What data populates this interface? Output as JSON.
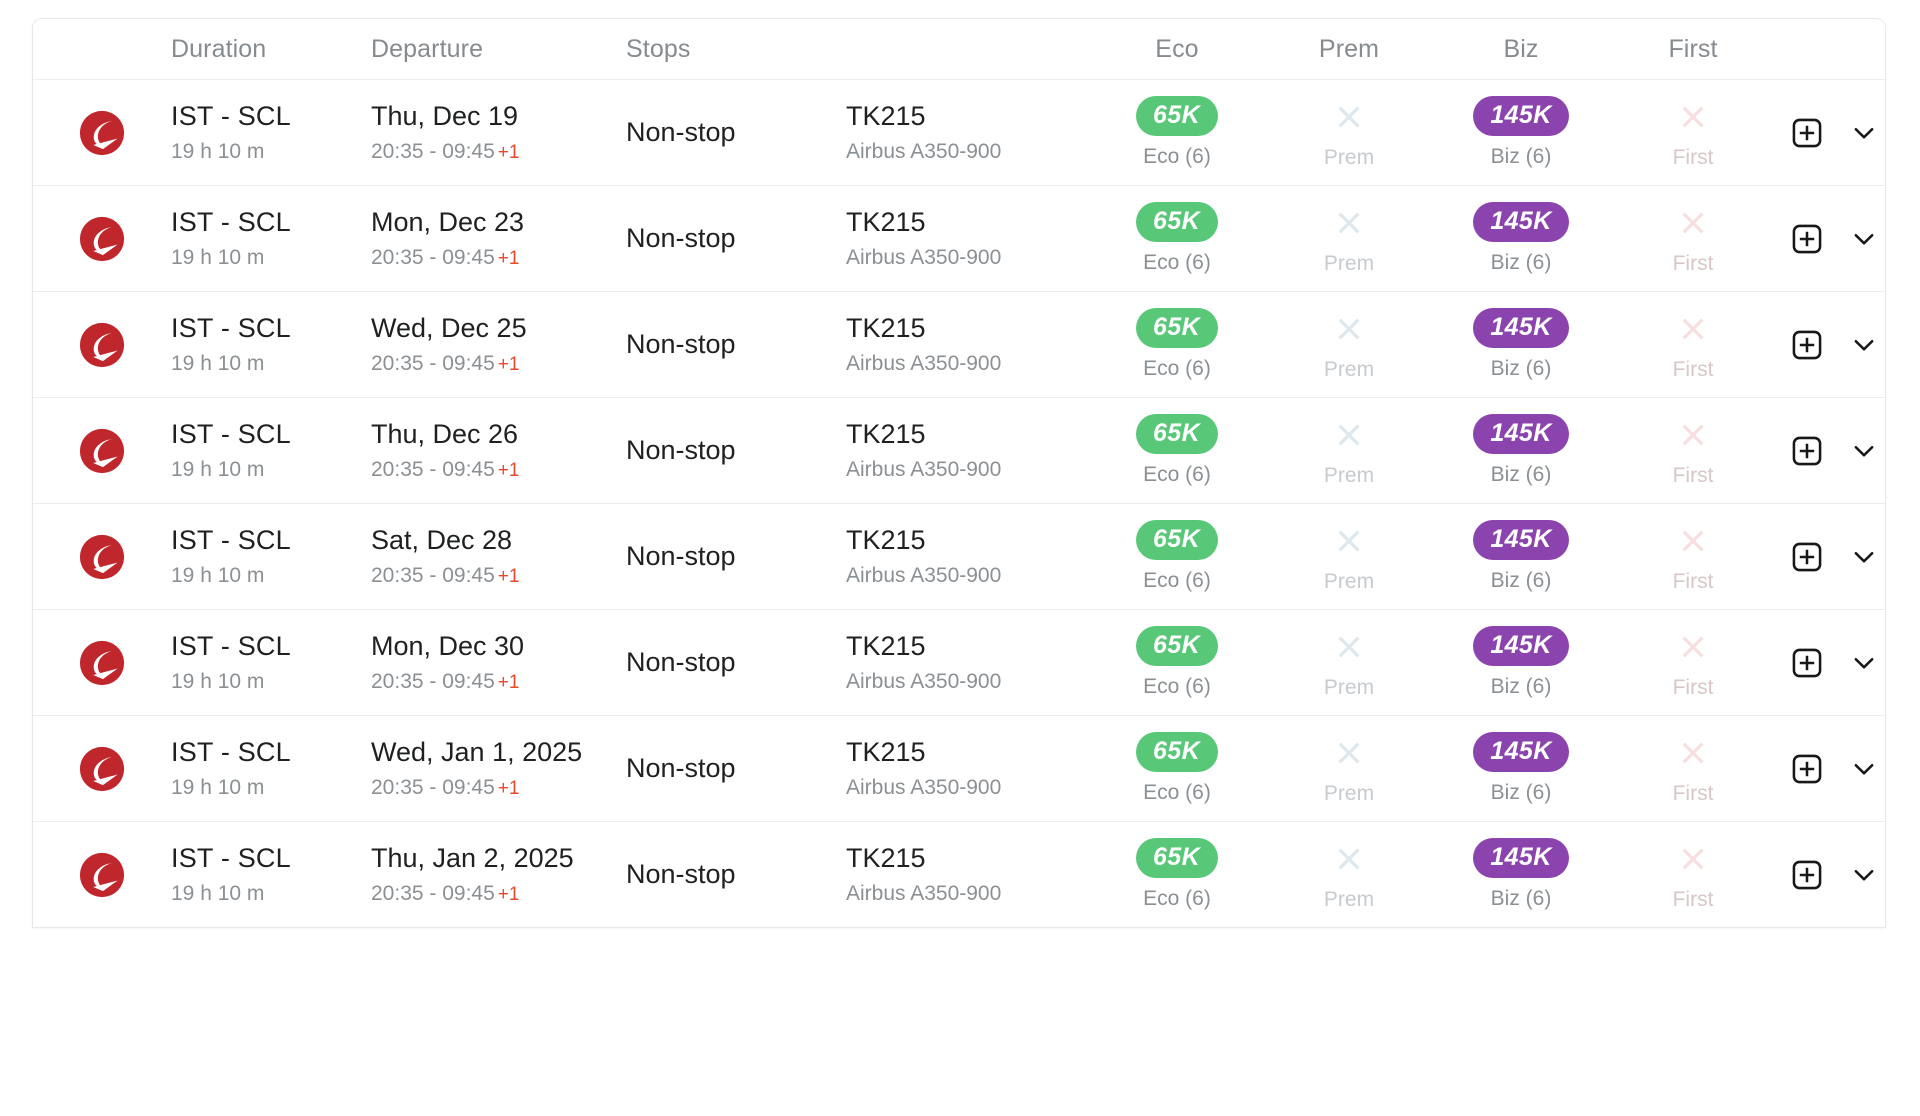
{
  "table": {
    "columns": [
      {
        "key": "airline",
        "label": "",
        "align": "center"
      },
      {
        "key": "duration",
        "label": "Duration",
        "align": "left"
      },
      {
        "key": "departure",
        "label": "Departure",
        "align": "left"
      },
      {
        "key": "stops",
        "label": "Stops",
        "align": "left"
      },
      {
        "key": "flight",
        "label": "",
        "align": "left"
      },
      {
        "key": "eco",
        "label": "Eco",
        "align": "center"
      },
      {
        "key": "prem",
        "label": "Prem",
        "align": "center"
      },
      {
        "key": "biz",
        "label": "Biz",
        "align": "center"
      },
      {
        "key": "first",
        "label": "First",
        "align": "center"
      },
      {
        "key": "actions",
        "label": "",
        "align": "left"
      }
    ],
    "headers": {
      "duration": "Duration",
      "departure": "Departure",
      "stops": "Stops",
      "eco": "Eco",
      "prem": "Prem",
      "biz": "Biz",
      "first": "First"
    },
    "rows": [
      {
        "airline": "Turkish Airlines",
        "route": "IST - SCL",
        "duration": "19 h 10 m",
        "date": "Thu, Dec 19",
        "times": "20:35 - 09:45",
        "day_offset": "+1",
        "stops": "Non-stop",
        "flight_number": "TK215",
        "aircraft": "Airbus A350-900",
        "eco": {
          "available": true,
          "price": "65K",
          "label": "Eco (6)"
        },
        "prem": {
          "available": false,
          "price": "",
          "label": "Prem"
        },
        "biz": {
          "available": true,
          "price": "145K",
          "label": "Biz (6)"
        },
        "first": {
          "available": false,
          "price": "",
          "label": "First"
        }
      },
      {
        "airline": "Turkish Airlines",
        "route": "IST - SCL",
        "duration": "19 h 10 m",
        "date": "Mon, Dec 23",
        "times": "20:35 - 09:45",
        "day_offset": "+1",
        "stops": "Non-stop",
        "flight_number": "TK215",
        "aircraft": "Airbus A350-900",
        "eco": {
          "available": true,
          "price": "65K",
          "label": "Eco (6)"
        },
        "prem": {
          "available": false,
          "price": "",
          "label": "Prem"
        },
        "biz": {
          "available": true,
          "price": "145K",
          "label": "Biz (6)"
        },
        "first": {
          "available": false,
          "price": "",
          "label": "First"
        }
      },
      {
        "airline": "Turkish Airlines",
        "route": "IST - SCL",
        "duration": "19 h 10 m",
        "date": "Wed, Dec 25",
        "times": "20:35 - 09:45",
        "day_offset": "+1",
        "stops": "Non-stop",
        "flight_number": "TK215",
        "aircraft": "Airbus A350-900",
        "eco": {
          "available": true,
          "price": "65K",
          "label": "Eco (6)"
        },
        "prem": {
          "available": false,
          "price": "",
          "label": "Prem"
        },
        "biz": {
          "available": true,
          "price": "145K",
          "label": "Biz (6)"
        },
        "first": {
          "available": false,
          "price": "",
          "label": "First"
        }
      },
      {
        "airline": "Turkish Airlines",
        "route": "IST - SCL",
        "duration": "19 h 10 m",
        "date": "Thu, Dec 26",
        "times": "20:35 - 09:45",
        "day_offset": "+1",
        "stops": "Non-stop",
        "flight_number": "TK215",
        "aircraft": "Airbus A350-900",
        "eco": {
          "available": true,
          "price": "65K",
          "label": "Eco (6)"
        },
        "prem": {
          "available": false,
          "price": "",
          "label": "Prem"
        },
        "biz": {
          "available": true,
          "price": "145K",
          "label": "Biz (6)"
        },
        "first": {
          "available": false,
          "price": "",
          "label": "First"
        }
      },
      {
        "airline": "Turkish Airlines",
        "route": "IST - SCL",
        "duration": "19 h 10 m",
        "date": "Sat, Dec 28",
        "times": "20:35 - 09:45",
        "day_offset": "+1",
        "stops": "Non-stop",
        "flight_number": "TK215",
        "aircraft": "Airbus A350-900",
        "eco": {
          "available": true,
          "price": "65K",
          "label": "Eco (6)"
        },
        "prem": {
          "available": false,
          "price": "",
          "label": "Prem"
        },
        "biz": {
          "available": true,
          "price": "145K",
          "label": "Biz (6)"
        },
        "first": {
          "available": false,
          "price": "",
          "label": "First"
        }
      },
      {
        "airline": "Turkish Airlines",
        "route": "IST - SCL",
        "duration": "19 h 10 m",
        "date": "Mon, Dec 30",
        "times": "20:35 - 09:45",
        "day_offset": "+1",
        "stops": "Non-stop",
        "flight_number": "TK215",
        "aircraft": "Airbus A350-900",
        "eco": {
          "available": true,
          "price": "65K",
          "label": "Eco (6)"
        },
        "prem": {
          "available": false,
          "price": "",
          "label": "Prem"
        },
        "biz": {
          "available": true,
          "price": "145K",
          "label": "Biz (6)"
        },
        "first": {
          "available": false,
          "price": "",
          "label": "First"
        }
      },
      {
        "airline": "Turkish Airlines",
        "route": "IST - SCL",
        "duration": "19 h 10 m",
        "date": "Wed, Jan 1, 2025",
        "times": "20:35 - 09:45",
        "day_offset": "+1",
        "stops": "Non-stop",
        "flight_number": "TK215",
        "aircraft": "Airbus A350-900",
        "eco": {
          "available": true,
          "price": "65K",
          "label": "Eco (6)"
        },
        "prem": {
          "available": false,
          "price": "",
          "label": "Prem"
        },
        "biz": {
          "available": true,
          "price": "145K",
          "label": "Biz (6)"
        },
        "first": {
          "available": false,
          "price": "",
          "label": "First"
        }
      },
      {
        "airline": "Turkish Airlines",
        "route": "IST - SCL",
        "duration": "19 h 10 m",
        "date": "Thu, Jan 2, 2025",
        "times": "20:35 - 09:45",
        "day_offset": "+1",
        "stops": "Non-stop",
        "flight_number": "TK215",
        "aircraft": "Airbus A350-900",
        "eco": {
          "available": true,
          "price": "65K",
          "label": "Eco (6)"
        },
        "prem": {
          "available": false,
          "price": "",
          "label": "Prem"
        },
        "biz": {
          "available": true,
          "price": "145K",
          "label": "Biz (6)"
        },
        "first": {
          "available": false,
          "price": "",
          "label": "First"
        }
      }
    ],
    "row_actions": {
      "add_label": "add-to-compare",
      "expand_label": "expand-row"
    }
  },
  "icons": {
    "airline_logo": "turkish-airlines-logo",
    "unavailable": "x-icon",
    "add": "plus-square-icon",
    "expand": "chevron-down-icon"
  },
  "colors": {
    "eco_pill": "#58c878",
    "biz_pill": "#8b44ad",
    "unavailable_blue": "#dde7ee",
    "unavailable_pink": "#f8dede",
    "logo_red": "#c0272d",
    "plus_one": "#e8482b",
    "muted_text": "#8b9094",
    "header_text": "#868b8f",
    "primary_text": "#1e2022"
  }
}
